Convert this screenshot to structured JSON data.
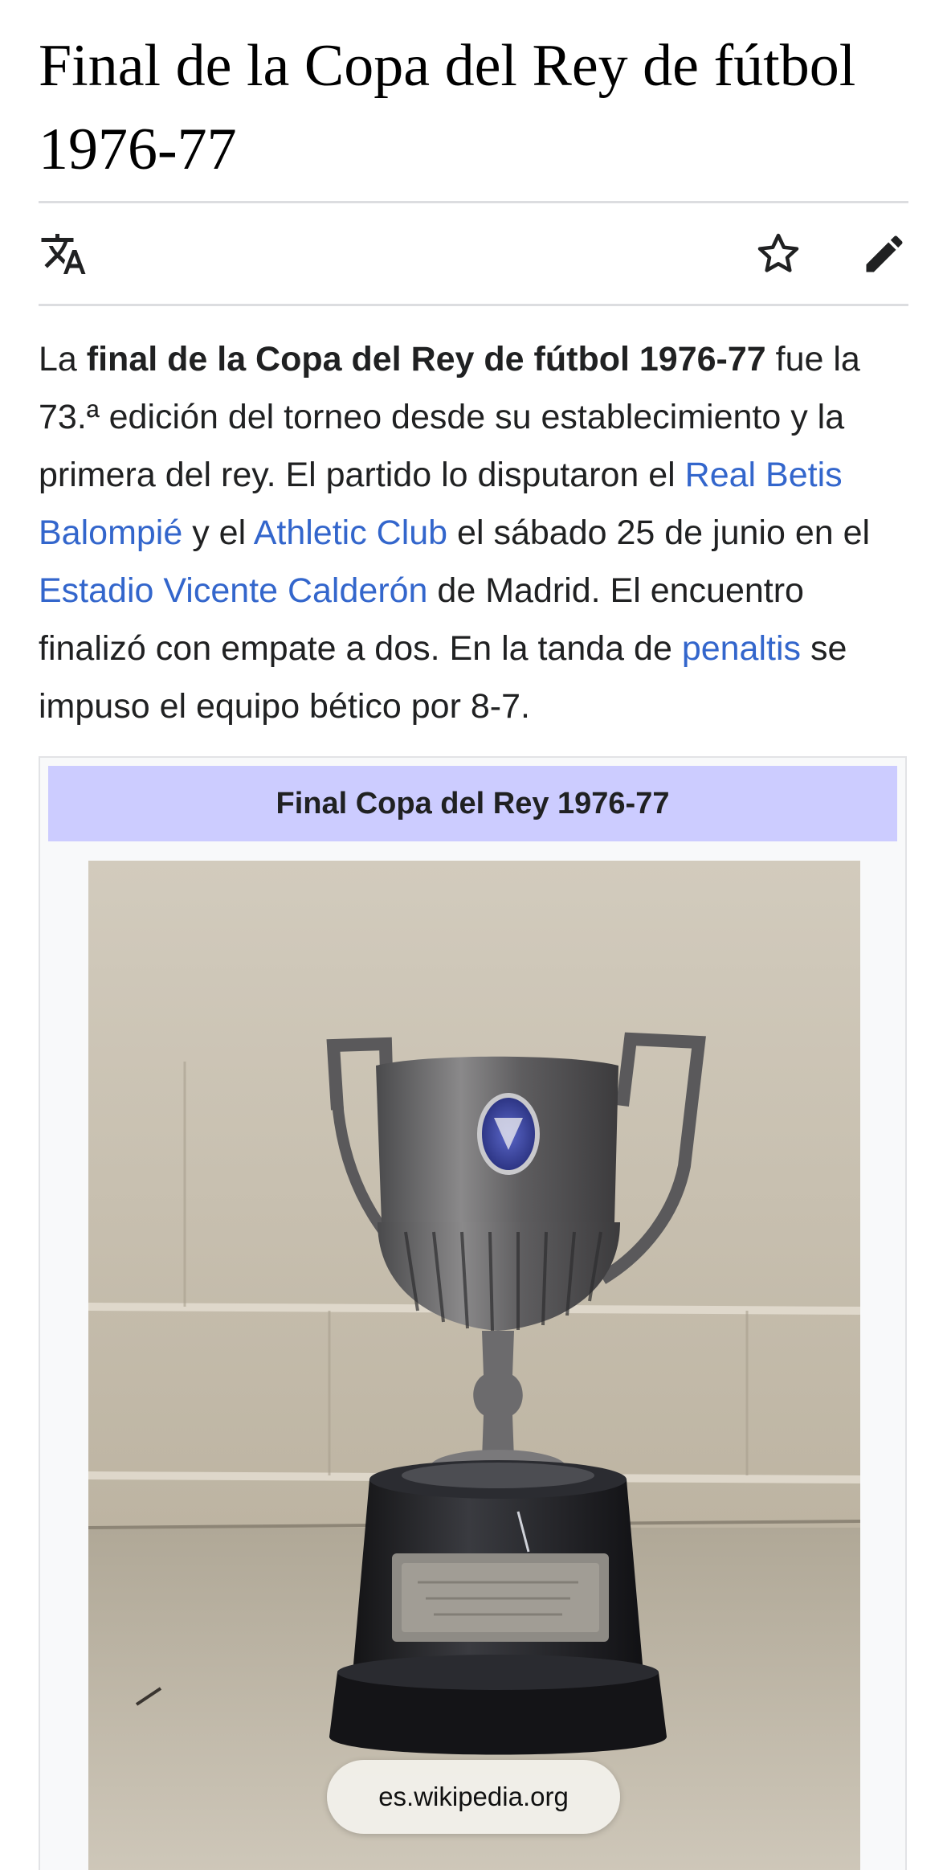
{
  "article": {
    "title": "Final de la Copa del Rey de fútbol 1976-77"
  },
  "toolbar": {
    "language_icon": "translate-icon",
    "watch_icon": "star-icon",
    "edit_icon": "pencil-icon"
  },
  "lead": {
    "t1": "La ",
    "bold": "final de la Copa del Rey de fútbol 1976-77",
    "t2": " fue la 73.ª edición del torneo desde su establecimiento y la primera del rey. El partido lo disputaron el ",
    "link_betis": "Real Betis Balompié",
    "t3": " y el ",
    "link_athletic": "Athletic Club",
    "t4": " el sábado 25 de junio en el ",
    "link_estadio": "Estadio Vicente Calderón",
    "t5": " de Madrid. El encuentro finalizó con empate a dos. En la tanda de ",
    "link_penaltis": "penaltis",
    "t6": " se impuso el equipo bético por 8-7."
  },
  "infobox": {
    "header": "Final Copa del Rey 1976-77"
  },
  "browser": {
    "url": "es.wikipedia.org"
  },
  "colors": {
    "link": "#3366cc",
    "infobox_header_bg": "#ccccff",
    "rule": "#dcdde0"
  }
}
